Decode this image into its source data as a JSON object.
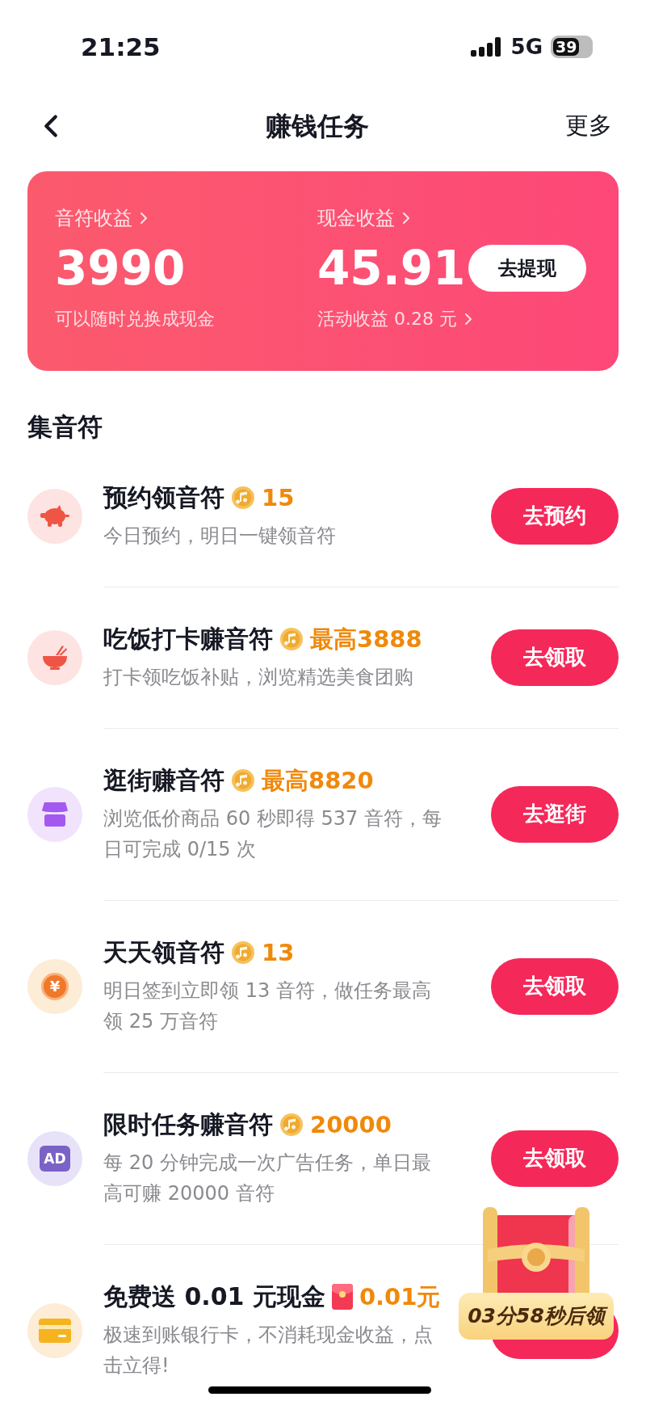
{
  "status_bar": {
    "time": "21:25",
    "network": "5G",
    "battery": "39"
  },
  "nav": {
    "title": "赚钱任务",
    "action": "更多"
  },
  "earnings": {
    "items": [
      {
        "label": "音符收益",
        "value": "3990",
        "note": "可以随时兑换成现金"
      },
      {
        "label": "现金收益",
        "value": "45.91",
        "note": "活动收益 0.28 元"
      }
    ],
    "button": "去提现"
  },
  "section": {
    "title": "集音符"
  },
  "tasks": [
    {
      "icon": {
        "kind": "piggy"
      },
      "title": "预约领音符",
      "kind": "note",
      "reward": "15",
      "description": "今日预约，明日一键领音符",
      "button": "去预约"
    },
    {
      "icon": {
        "kind": "bowl"
      },
      "title": "吃饭打卡赚音符",
      "kind": "note",
      "reward": "最高3888",
      "description": "打卡领吃饭补贴，浏览精选美食团购",
      "button": "去领取"
    },
    {
      "icon": {
        "kind": "shop"
      },
      "title": "逛街赚音符",
      "kind": "note",
      "reward": "最高8820",
      "description": "浏览低价商品 60 秒即得 537 音符，每日可完成 0/15 次",
      "button": "去逛街"
    },
    {
      "icon": {
        "kind": "yuan",
        "text": "¥"
      },
      "title": "天天领音符",
      "kind": "note",
      "reward": "13",
      "description": "明日签到立即领 13 音符，做任务最高领 25 万音符",
      "button": "去领取"
    },
    {
      "icon": {
        "kind": "ad",
        "text": "AD"
      },
      "title": "限时任务赚音符",
      "kind": "note",
      "reward": "20000",
      "description": "每 20 分钟完成一次广告任务，单日最高可赚 20000 音符",
      "button": "去领取"
    },
    {
      "icon": {
        "kind": "card"
      },
      "title": "免费送 0.01 元现金",
      "kind": "red_packet",
      "reward": "0.01元",
      "description": "极速到账银行卡，不消耗现金收益，点击立得!"
    }
  ],
  "floating": {
    "timer": "03分58秒后领"
  }
}
